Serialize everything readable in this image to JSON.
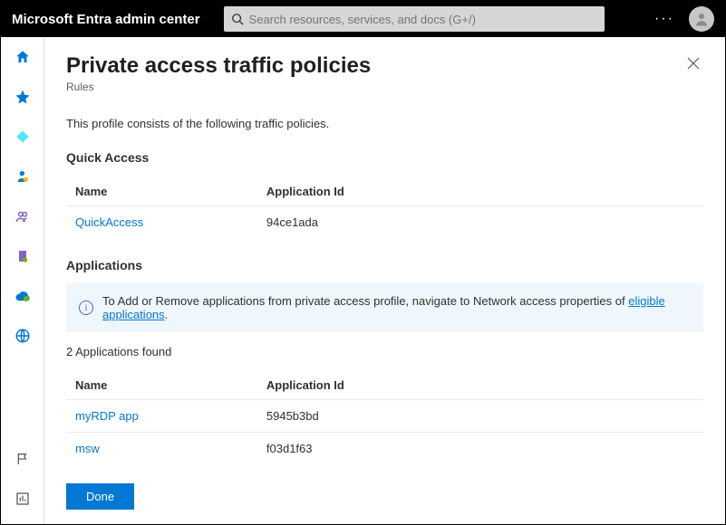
{
  "header": {
    "brand": "Microsoft Entra admin center",
    "searchPlaceholder": "Search resources, services, and docs (G+/)"
  },
  "page": {
    "title": "Private access traffic policies",
    "subtitle": "Rules",
    "description": "This profile consists of the following traffic policies."
  },
  "quickAccess": {
    "heading": "Quick Access",
    "columns": {
      "name": "Name",
      "appId": "Application Id"
    },
    "rows": [
      {
        "name": "QuickAccess",
        "appId": "94ce1ada"
      }
    ]
  },
  "applications": {
    "heading": "Applications",
    "info": {
      "prefix": "To Add or Remove applications from private access profile, navigate to Network access properties of ",
      "linkText": "eligible applications",
      "suffix": "."
    },
    "countLabel": "2 Applications found",
    "columns": {
      "name": "Name",
      "appId": "Application Id"
    },
    "rows": [
      {
        "name": "myRDP app",
        "appId": "5945b3bd"
      },
      {
        "name": "msw",
        "appId": "f03d1f63"
      }
    ]
  },
  "buttons": {
    "done": "Done"
  }
}
